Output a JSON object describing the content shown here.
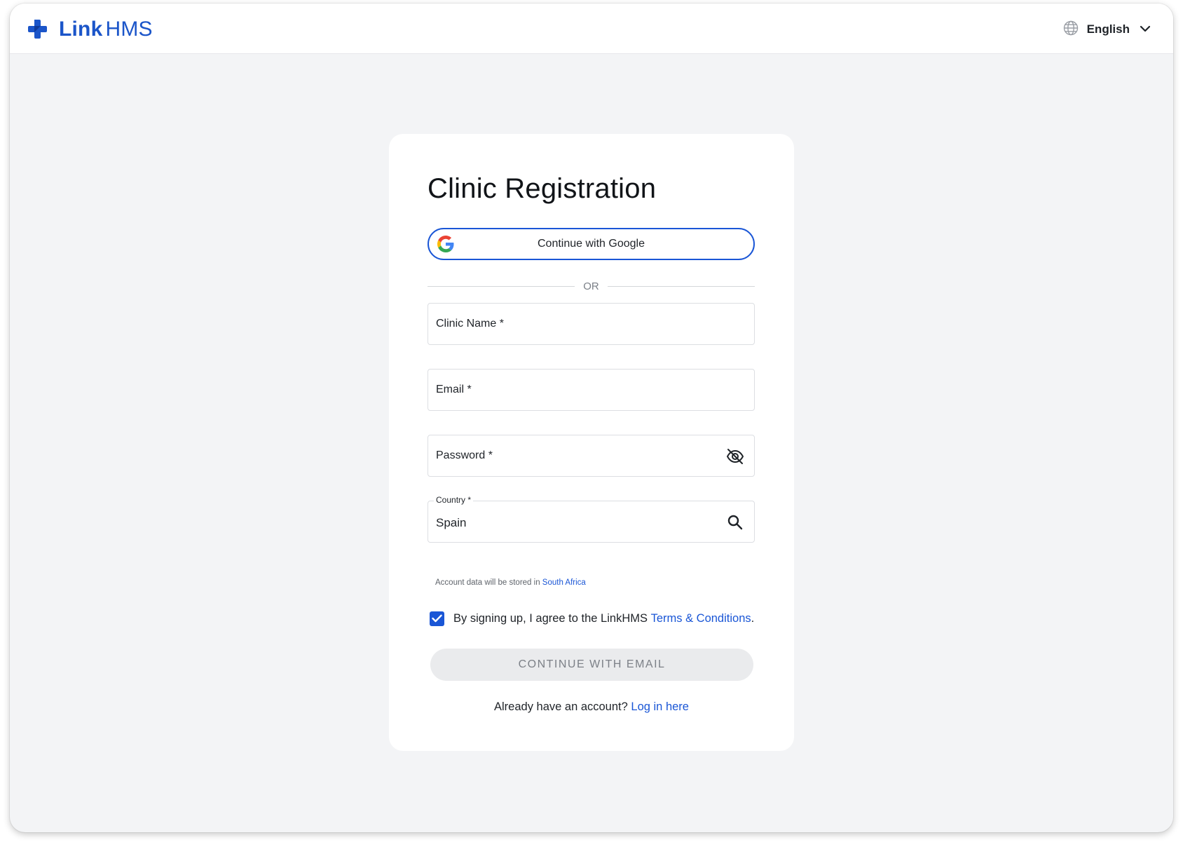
{
  "header": {
    "brand_link": "Link",
    "brand_hms": "HMS",
    "language": "English",
    "icons": {
      "language": "globe-icon",
      "dropdown": "chevron-down-icon",
      "logo": "cross-logo-icon"
    }
  },
  "form": {
    "title": "Clinic Registration",
    "google_button": "Continue with Google",
    "divider": "OR",
    "clinic_name_label": "Clinic Name *",
    "email_label": "Email *",
    "password_label": "Password *",
    "country_label": "Country *",
    "country_value": "Spain",
    "helper_prefix": "Account data will be stored in ",
    "helper_region": "South Africa",
    "terms_prefix": "By signing up, I agree to the LinkHMS ",
    "terms_link": "Terms & Conditions",
    "terms_suffix": ".",
    "terms_checked": true,
    "submit_button": "CONTINUE WITH EMAIL",
    "login_prompt": "Already have an account?",
    "login_link": "Log in here",
    "icons": {
      "password": "eye-off-icon",
      "country": "search-icon",
      "google": "google-icon"
    }
  },
  "colors": {
    "accent": "#1a56d6",
    "brand": "#1b55c9",
    "background": "#f3f4f6",
    "disabled_button": "#eaebed"
  }
}
